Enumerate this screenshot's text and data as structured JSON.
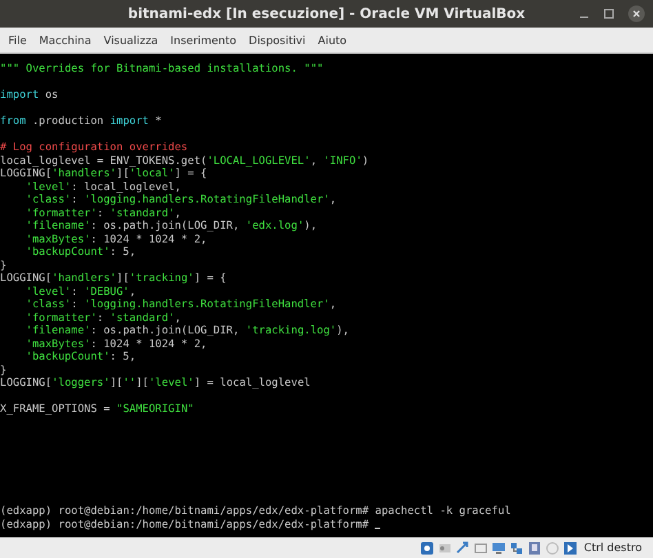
{
  "window": {
    "title": "bitnami-edx [In esecuzione] - Oracle VM VirtualBox"
  },
  "menu": [
    "File",
    "Macchina",
    "Visualizza",
    "Inserimento",
    "Dispositivi",
    "Aiuto"
  ],
  "script_lines": [
    {
      "kind": "code",
      "segments": [
        {
          "kind": "string",
          "text": "\"\"\" Overrides for Bitnami-based installations. \"\"\""
        }
      ]
    },
    {
      "kind": "blank"
    },
    {
      "kind": "code",
      "segments": [
        {
          "kind": "keyword",
          "text": "import"
        },
        {
          "kind": "plain",
          "text": " os"
        }
      ]
    },
    {
      "kind": "blank"
    },
    {
      "kind": "code",
      "segments": [
        {
          "kind": "keyword",
          "text": "from"
        },
        {
          "kind": "plain",
          "text": " .production "
        },
        {
          "kind": "keyword",
          "text": "import"
        },
        {
          "kind": "plain",
          "text": " *"
        }
      ]
    },
    {
      "kind": "blank"
    },
    {
      "kind": "code",
      "segments": [
        {
          "kind": "comment",
          "text": "# Log configuration overrides"
        }
      ]
    },
    {
      "kind": "code",
      "segments": [
        {
          "kind": "plain",
          "text": "local_loglevel = ENV_TOKENS.get("
        },
        {
          "kind": "string",
          "text": "'LOCAL_LOGLEVEL'"
        },
        {
          "kind": "plain",
          "text": ", "
        },
        {
          "kind": "string",
          "text": "'INFO'"
        },
        {
          "kind": "plain",
          "text": ")"
        }
      ]
    },
    {
      "kind": "code",
      "segments": [
        {
          "kind": "plain",
          "text": "LOGGING["
        },
        {
          "kind": "string",
          "text": "'handlers'"
        },
        {
          "kind": "plain",
          "text": "]["
        },
        {
          "kind": "string",
          "text": "'local'"
        },
        {
          "kind": "plain",
          "text": "] = {"
        }
      ]
    },
    {
      "kind": "code",
      "indented": true,
      "segments": [
        {
          "kind": "string",
          "text": "'level'"
        },
        {
          "kind": "plain",
          "text": ": local_loglevel,"
        }
      ]
    },
    {
      "kind": "code",
      "indented": true,
      "segments": [
        {
          "kind": "string",
          "text": "'class'"
        },
        {
          "kind": "plain",
          "text": ": "
        },
        {
          "kind": "string",
          "text": "'logging.handlers.RotatingFileHandler'"
        },
        {
          "kind": "plain",
          "text": ","
        }
      ]
    },
    {
      "kind": "code",
      "indented": true,
      "segments": [
        {
          "kind": "string",
          "text": "'formatter'"
        },
        {
          "kind": "plain",
          "text": ": "
        },
        {
          "kind": "string",
          "text": "'standard'"
        },
        {
          "kind": "plain",
          "text": ","
        }
      ]
    },
    {
      "kind": "code",
      "indented": true,
      "segments": [
        {
          "kind": "string",
          "text": "'filename'"
        },
        {
          "kind": "plain",
          "text": ": os.path.join(LOG_DIR, "
        },
        {
          "kind": "string",
          "text": "'edx.log'"
        },
        {
          "kind": "plain",
          "text": "),"
        }
      ]
    },
    {
      "kind": "code",
      "indented": true,
      "segments": [
        {
          "kind": "string",
          "text": "'maxBytes'"
        },
        {
          "kind": "plain",
          "text": ": 1024 * 1024 * 2,"
        }
      ]
    },
    {
      "kind": "code",
      "indented": true,
      "segments": [
        {
          "kind": "string",
          "text": "'backupCount'"
        },
        {
          "kind": "plain",
          "text": ": 5,"
        }
      ]
    },
    {
      "kind": "code",
      "segments": [
        {
          "kind": "plain",
          "text": "}"
        }
      ]
    },
    {
      "kind": "code",
      "segments": [
        {
          "kind": "plain",
          "text": "LOGGING["
        },
        {
          "kind": "string",
          "text": "'handlers'"
        },
        {
          "kind": "plain",
          "text": "]["
        },
        {
          "kind": "string",
          "text": "'tracking'"
        },
        {
          "kind": "plain",
          "text": "] = {"
        }
      ]
    },
    {
      "kind": "code",
      "indented": true,
      "segments": [
        {
          "kind": "string",
          "text": "'level'"
        },
        {
          "kind": "plain",
          "text": ": "
        },
        {
          "kind": "string",
          "text": "'DEBUG'"
        },
        {
          "kind": "plain",
          "text": ","
        }
      ]
    },
    {
      "kind": "code",
      "indented": true,
      "segments": [
        {
          "kind": "string",
          "text": "'class'"
        },
        {
          "kind": "plain",
          "text": ": "
        },
        {
          "kind": "string",
          "text": "'logging.handlers.RotatingFileHandler'"
        },
        {
          "kind": "plain",
          "text": ","
        }
      ]
    },
    {
      "kind": "code",
      "indented": true,
      "segments": [
        {
          "kind": "string",
          "text": "'formatter'"
        },
        {
          "kind": "plain",
          "text": ": "
        },
        {
          "kind": "string",
          "text": "'standard'"
        },
        {
          "kind": "plain",
          "text": ","
        }
      ]
    },
    {
      "kind": "code",
      "indented": true,
      "segments": [
        {
          "kind": "string",
          "text": "'filename'"
        },
        {
          "kind": "plain",
          "text": ": os.path.join(LOG_DIR, "
        },
        {
          "kind": "string",
          "text": "'tracking.log'"
        },
        {
          "kind": "plain",
          "text": "),"
        }
      ]
    },
    {
      "kind": "code",
      "indented": true,
      "segments": [
        {
          "kind": "string",
          "text": "'maxBytes'"
        },
        {
          "kind": "plain",
          "text": ": 1024 * 1024 * 2,"
        }
      ]
    },
    {
      "kind": "code",
      "indented": true,
      "segments": [
        {
          "kind": "string",
          "text": "'backupCount'"
        },
        {
          "kind": "plain",
          "text": ": 5,"
        }
      ]
    },
    {
      "kind": "code",
      "segments": [
        {
          "kind": "plain",
          "text": "}"
        }
      ]
    },
    {
      "kind": "code",
      "segments": [
        {
          "kind": "plain",
          "text": "LOGGING["
        },
        {
          "kind": "string",
          "text": "'loggers'"
        },
        {
          "kind": "plain",
          "text": "]["
        },
        {
          "kind": "string",
          "text": "''"
        },
        {
          "kind": "plain",
          "text": "]["
        },
        {
          "kind": "string",
          "text": "'level'"
        },
        {
          "kind": "plain",
          "text": "] = local_loglevel"
        }
      ]
    },
    {
      "kind": "blank"
    },
    {
      "kind": "code",
      "segments": [
        {
          "kind": "plain",
          "text": "X_FRAME_OPTIONS = "
        },
        {
          "kind": "string",
          "text": "\"SAMEORIGIN\""
        }
      ]
    }
  ],
  "prompt_lines": [
    {
      "text": "(edxapp) root@debian:/home/bitnami/apps/edx/edx-platform# apachectl -k graceful",
      "cursor": false
    },
    {
      "text": "(edxapp) root@debian:/home/bitnami/apps/edx/edx-platform# ",
      "cursor": true
    }
  ],
  "status_bar": {
    "host_key": "Ctrl destro"
  }
}
